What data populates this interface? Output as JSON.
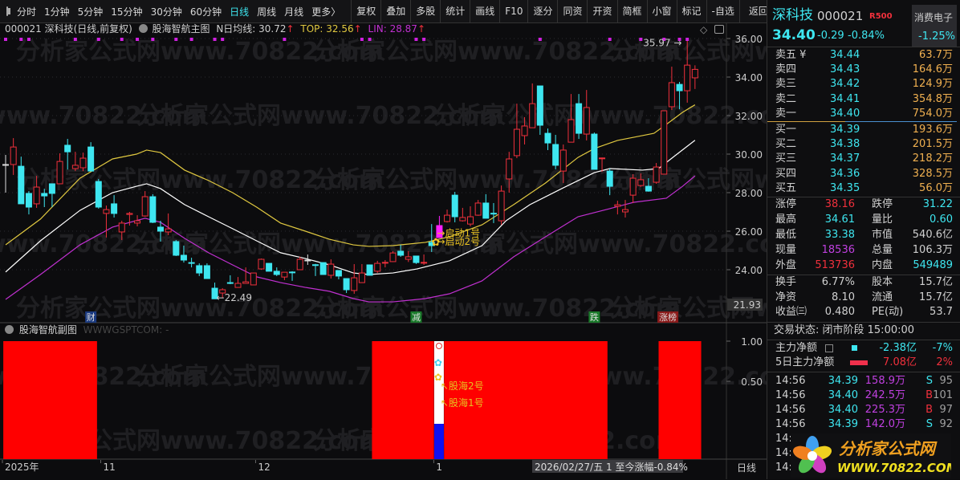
{
  "toolbar": {
    "periods": [
      "分时",
      "1分钟",
      "5分钟",
      "15分钟",
      "30分钟",
      "60分钟",
      "日线",
      "周线",
      "月线",
      "更多〉"
    ],
    "active_period": "日线",
    "buttons": [
      "复权",
      "叠加",
      "多股",
      "统计",
      "画线",
      "F10",
      "逐分",
      "同资",
      "开资",
      "简框",
      "小窗",
      "标记",
      "-自选",
      "返回"
    ]
  },
  "colors": {
    "up": "#f0303c",
    "down": "#3ee6f0",
    "top_line": "#e0c840",
    "n_line": "#ffffff",
    "lin_line": "#c030d0",
    "signal_block": "#ff0000",
    "signal_blue": "#1010f0",
    "marker": "#d020e0"
  },
  "chart_header": {
    "title": "000021 深科技(日线,前复权)",
    "indicator": "股海智航主图",
    "n_label": "N日均线: 30.72",
    "top_label": "TOP: 32.56",
    "lin_label": "LIN: 28.87",
    "arrow": "↑"
  },
  "watermark": "分析家公式网www.70822.com",
  "chart_data": {
    "type": "candlestick",
    "ylim": [
      21.93,
      36.5
    ],
    "y_ticks": [
      "36.00",
      "34.00",
      "32.00",
      "30.00",
      "28.00",
      "26.00",
      "24.00"
    ],
    "y_tick_values": [
      36,
      34,
      32,
      30,
      28,
      26,
      24
    ],
    "axis_low_label": "21.93",
    "candles": [
      [
        29.46,
        29.96,
        28.0,
        29.46,
        "w"
      ],
      [
        29.46,
        30.83,
        28.92,
        30.37
      ],
      [
        29.37,
        29.87,
        27.42,
        27.42
      ],
      [
        27.96,
        28.08,
        26.87,
        27.25
      ],
      [
        27.42,
        28.87,
        27.21,
        28.29
      ],
      [
        27.96,
        28.2,
        27.25,
        27.83
      ],
      [
        28.46,
        28.46,
        27.25,
        27.96
      ],
      [
        28.46,
        30.04,
        28.46,
        29.62
      ],
      [
        30.46,
        30.79,
        29.2,
        30.12
      ],
      [
        29.25,
        30.12,
        29.12,
        29.42
      ],
      [
        29.29,
        30.08,
        29.12,
        29.79
      ],
      [
        30.37,
        30.62,
        29.12,
        29.12
      ],
      [
        28.58,
        28.71,
        27.17,
        27.25
      ],
      [
        26.92,
        27.33,
        25.67,
        27.12
      ],
      [
        27.42,
        27.87,
        26.71,
        26.92
      ],
      [
        25.96,
        26.54,
        25.54,
        26.42
      ],
      [
        26.87,
        27.0,
        26.29,
        26.92
      ],
      [
        26.42,
        26.83,
        26.25,
        26.54
      ],
      [
        26.79,
        28.08,
        26.75,
        27.79
      ],
      [
        27.79,
        27.92,
        26.42,
        26.46
      ],
      [
        26.21,
        26.54,
        25.46,
        26.0
      ],
      [
        25.96,
        26.92,
        25.79,
        26.12
      ],
      [
        25.46,
        25.54,
        24.71,
        24.75
      ],
      [
        24.75,
        25.25,
        24.37,
        24.5
      ],
      [
        24.37,
        24.62,
        24.12,
        24.33
      ],
      [
        24.21,
        24.33,
        23.67,
        23.83
      ],
      [
        24.21,
        24.33,
        23.54,
        23.54
      ],
      [
        23.04,
        23.33,
        22.49,
        22.49
      ],
      [
        22.79,
        23.04,
        22.54,
        22.96
      ],
      [
        23.33,
        23.71,
        23.25,
        23.29
      ],
      [
        23.08,
        23.62,
        23.08,
        23.29
      ],
      [
        23.29,
        24.12,
        23.29,
        23.37
      ],
      [
        23.21,
        23.83,
        23.21,
        23.83
      ],
      [
        24.04,
        24.58,
        24.0,
        24.54
      ],
      [
        24.33,
        24.33,
        23.92,
        23.92
      ],
      [
        23.92,
        24.12,
        23.67,
        23.75
      ],
      [
        23.62,
        23.87,
        23.46,
        23.87
      ],
      [
        23.88,
        23.92,
        23.42,
        23.86
      ],
      [
        24.0,
        24.67,
        24.0,
        24.54
      ],
      [
        24.5,
        24.79,
        24.25,
        24.5,
        "w"
      ],
      [
        24.26,
        24.3,
        23.67,
        24.24
      ],
      [
        24.37,
        24.37,
        23.75,
        23.75
      ],
      [
        23.71,
        24.54,
        23.54,
        24.29
      ],
      [
        23.96,
        23.96,
        23.5,
        23.67
      ],
      [
        23.54,
        23.54,
        22.79,
        22.96
      ],
      [
        22.92,
        24.29,
        22.75,
        23.58
      ],
      [
        23.33,
        24.29,
        23.33,
        23.83
      ],
      [
        24.25,
        24.25,
        23.71,
        23.71
      ],
      [
        23.92,
        24.46,
        23.83,
        24.33
      ],
      [
        24.36,
        24.5,
        24.12,
        24.38
      ],
      [
        24.42,
        24.96,
        24.4,
        24.87
      ],
      [
        24.96,
        25.29,
        24.67,
        24.75
      ],
      [
        24.54,
        24.96,
        24.4,
        24.67
      ],
      [
        24.71,
        24.71,
        24.3,
        24.37
      ],
      [
        24.36,
        24.79,
        24.25,
        24.38
      ],
      [
        25.42,
        26.37,
        24.92,
        25.25
      ],
      [
        25.67,
        26.79,
        25.67,
        26.29,
        "m"
      ],
      [
        26.5,
        27.12,
        26.45,
        26.83
      ],
      [
        27.87,
        28.04,
        26.46,
        26.75
      ],
      [
        26.54,
        27.21,
        26.5,
        26.71
      ],
      [
        26.37,
        27.29,
        26.25,
        26.75
      ],
      [
        26.83,
        27.62,
        26.8,
        27.46
      ],
      [
        27.46,
        27.92,
        26.67,
        26.67
      ],
      [
        26.93,
        27.46,
        26.42,
        26.91
      ],
      [
        26.54,
        28.37,
        26.33,
        28.08
      ],
      [
        28.71,
        30.12,
        28.0,
        29.75
      ],
      [
        29.92,
        32.62,
        29.79,
        31.29
      ],
      [
        30.96,
        31.92,
        30.5,
        31.46
      ],
      [
        31.37,
        33.67,
        31.37,
        32.62
      ],
      [
        33.54,
        33.54,
        31.0,
        31.5
      ],
      [
        31.08,
        31.33,
        30.21,
        30.58
      ],
      [
        30.5,
        31.0,
        29.21,
        29.42
      ],
      [
        29.12,
        30.5,
        28.5,
        30.21
      ],
      [
        30.62,
        33.12,
        30.62,
        31.79
      ],
      [
        32.62,
        33.12,
        30.79,
        31.08
      ],
      [
        31.04,
        33.33,
        30.71,
        32.42
      ],
      [
        31.04,
        31.12,
        29.21,
        29.21
      ],
      [
        29.78,
        29.82,
        29.08,
        29.8
      ],
      [
        29.12,
        29.25,
        27.87,
        28.33
      ],
      [
        27.29,
        27.58,
        26.87,
        27.37
      ],
      [
        27.0,
        27.62,
        26.71,
        27.12
      ],
      [
        27.87,
        28.96,
        27.46,
        28.75
      ],
      [
        28.37,
        29.0,
        28.3,
        28.67
      ],
      [
        28.33,
        28.75,
        28.05,
        28.08
      ],
      [
        28.54,
        29.54,
        28.46,
        29.33
      ],
      [
        28.96,
        32.25,
        28.96,
        32.25
      ],
      [
        32.46,
        34.54,
        32.29,
        33.71
      ],
      [
        33.62,
        33.75,
        32.33,
        33.29
      ],
      [
        33.29,
        35.97,
        32.67,
        34.62
      ],
      [
        33.96,
        34.61,
        33.38,
        34.4
      ]
    ],
    "series": [
      {
        "name": "TOP",
        "points": [
          [
            0,
            25.29
          ],
          [
            4.5,
            26.63
          ],
          [
            9.6,
            28.75
          ],
          [
            13.8,
            29.75
          ],
          [
            16.9,
            30.0
          ],
          [
            18.2,
            30.21
          ],
          [
            20,
            30.08
          ],
          [
            23.1,
            29.17
          ],
          [
            26.2,
            28.63
          ],
          [
            29.3,
            28.0
          ],
          [
            32.4,
            27.25
          ],
          [
            35.5,
            26.42
          ],
          [
            38.7,
            26.0
          ],
          [
            41.8,
            25.58
          ],
          [
            44.9,
            25.29
          ],
          [
            46.9,
            25.21
          ],
          [
            50,
            25.25
          ],
          [
            54.2,
            25.42
          ],
          [
            57.3,
            25.71
          ],
          [
            61.5,
            26.33
          ],
          [
            65.6,
            27.38
          ],
          [
            69.7,
            28.5
          ],
          [
            73.9,
            29.83
          ],
          [
            76,
            30.29
          ],
          [
            79,
            30.71
          ],
          [
            82.2,
            30.96
          ],
          [
            83.7,
            31.08
          ],
          [
            85.3,
            31.54
          ],
          [
            87.4,
            32.17
          ],
          [
            89,
            32.56
          ]
        ]
      },
      {
        "name": "N",
        "points": [
          [
            0,
            23.88
          ],
          [
            4.5,
            25.5
          ],
          [
            9.6,
            27.08
          ],
          [
            13.8,
            28.0
          ],
          [
            16.9,
            28.33
          ],
          [
            18.2,
            28.46
          ],
          [
            20,
            28.21
          ],
          [
            23.1,
            27.38
          ],
          [
            26.2,
            26.75
          ],
          [
            29.3,
            26.13
          ],
          [
            32.4,
            25.5
          ],
          [
            35.5,
            24.88
          ],
          [
            38.7,
            24.58
          ],
          [
            41.8,
            24.25
          ],
          [
            44.9,
            23.83
          ],
          [
            46.9,
            23.75
          ],
          [
            50,
            23.83
          ],
          [
            53.1,
            24.04
          ],
          [
            57.3,
            24.46
          ],
          [
            61.5,
            25.25
          ],
          [
            64.6,
            26.54
          ],
          [
            67.7,
            27.38
          ],
          [
            71.8,
            28.21
          ],
          [
            76,
            29.04
          ],
          [
            78,
            29.25
          ],
          [
            82.2,
            29.17
          ],
          [
            84.3,
            29.25
          ],
          [
            86.3,
            29.88
          ],
          [
            89,
            30.72
          ]
        ]
      },
      {
        "name": "LIN",
        "points": [
          [
            0,
            22.46
          ],
          [
            4.5,
            23.75
          ],
          [
            9.6,
            25.29
          ],
          [
            13.8,
            26.21
          ],
          [
            18,
            26.67
          ],
          [
            20,
            26.46
          ],
          [
            23.1,
            25.63
          ],
          [
            26.2,
            24.88
          ],
          [
            29.3,
            24.25
          ],
          [
            32.4,
            23.63
          ],
          [
            35.5,
            23.33
          ],
          [
            38.7,
            23.08
          ],
          [
            41.8,
            22.88
          ],
          [
            44.9,
            22.5
          ],
          [
            46.9,
            22.33
          ],
          [
            50,
            22.33
          ],
          [
            54.2,
            22.5
          ],
          [
            57.3,
            22.75
          ],
          [
            61.5,
            23.42
          ],
          [
            65.6,
            24.67
          ],
          [
            69.7,
            25.71
          ],
          [
            73.9,
            26.75
          ],
          [
            78,
            27.17
          ],
          [
            81.1,
            27.5
          ],
          [
            85.3,
            27.71
          ],
          [
            87.4,
            28.33
          ],
          [
            89,
            28.87
          ]
        ]
      }
    ],
    "top_markers": [
      0,
      2,
      3,
      9,
      12,
      15,
      17,
      19,
      22,
      24,
      27,
      28,
      36,
      46,
      47,
      53,
      54,
      69,
      78,
      82,
      85,
      87,
      88
    ],
    "annotations": [
      {
        "text": "22.49",
        "index": 27,
        "price": 22.49
      },
      {
        "text": "35.97",
        "index": 88,
        "price": 35.97
      },
      {
        "text": "→启动1号",
        "index": 56,
        "price": 25.9
      },
      {
        "text": "→启动2号",
        "index": 56,
        "price": 25.45
      }
    ],
    "signals": [
      {
        "text": "财",
        "index": 11,
        "bg": "#1a3a80"
      },
      {
        "text": "减",
        "index": 53,
        "bg": "#1a7a2a"
      },
      {
        "text": "跌",
        "index": 76,
        "bg": "#1a7a2a"
      },
      {
        "text": "涨榜",
        "index": 85.5,
        "bg": "#8a1a1a"
      }
    ],
    "sub": {
      "title": "股海智航副图",
      "subtitle": "WWWGSPTCOM: -",
      "y_ticks": [
        "1.00",
        "0.50"
      ],
      "blocks": [
        [
          -0.3,
          11.8
        ],
        [
          47.3,
          55.3
        ],
        [
          56.6,
          77.7
        ],
        [
          84.3,
          89.8
        ]
      ],
      "signal_index": 55.95,
      "labels": [
        "股海2号",
        "股海1号"
      ]
    },
    "x_labels": [
      {
        "text": "2025年",
        "index": 0
      },
      {
        "text": "11",
        "index": 13
      },
      {
        "text": "12",
        "index": 33
      },
      {
        "text": "1",
        "index": 56
      }
    ],
    "cursor_info": "2026/02/27/五 1 至今涨幅-0.84%",
    "period_label": "日线"
  },
  "quote": {
    "name": "深科技",
    "code": "000021",
    "badge": "R500",
    "sector": "消费电子",
    "sector_change": "-1.25%",
    "price": "34.40",
    "change": "-0.29",
    "change_pct": "-0.84%",
    "asks": [
      [
        "卖五 ¥",
        "34.44",
        "63.7万"
      ],
      [
        "卖四",
        "34.43",
        "164.6万"
      ],
      [
        "卖三",
        "34.42",
        "124.9万"
      ],
      [
        "卖二",
        "34.41",
        "354.8万"
      ],
      [
        "卖一",
        "34.40",
        "754.0万"
      ]
    ],
    "bids": [
      [
        "买一",
        "34.39",
        "193.6万"
      ],
      [
        "买二",
        "34.38",
        "201.5万"
      ],
      [
        "买三",
        "34.37",
        "218.2万"
      ],
      [
        "买四",
        "34.36",
        "328.5万"
      ],
      [
        "买五",
        "34.35",
        "56.0万"
      ]
    ],
    "stats": [
      [
        "涨停",
        "38.16",
        "跌停",
        "31.22"
      ],
      [
        "最高",
        "34.61",
        "量比",
        "0.60"
      ],
      [
        "最低",
        "33.38",
        "市值",
        "540.6亿"
      ],
      [
        "现量",
        "18536",
        "总量",
        "106.3万"
      ],
      [
        "外盘",
        "513736",
        "内盘",
        "549489"
      ]
    ],
    "fundamentals": [
      [
        "换手",
        "6.77%",
        "股本",
        "15.7亿"
      ],
      [
        "净资",
        "8.10",
        "流通",
        "15.7亿"
      ],
      [
        "收益㈢",
        "0.480",
        "PE(动)",
        "53.7"
      ]
    ],
    "status": "交易状态: 闭市阶段 15:00:00",
    "flows": [
      [
        "主力净额",
        "-2.38亿",
        "-7%"
      ],
      [
        "5日主力净额",
        "7.08亿",
        "2%"
      ]
    ],
    "ticks": [
      [
        "14:56",
        "34.39",
        "158.9万",
        "S",
        "95"
      ],
      [
        "14:56",
        "34.40",
        "242.5万",
        "B",
        "101"
      ],
      [
        "14:56",
        "34.40",
        "225.3万",
        "B",
        "97"
      ],
      [
        "14:56",
        "34.39",
        "142.0万",
        "S",
        "92"
      ],
      [
        "14:5",
        "",
        "",
        "",
        ""
      ],
      [
        "14:5",
        "",
        "",
        "",
        ""
      ],
      [
        "14:5",
        "",
        "",
        "",
        ""
      ]
    ],
    "logo_text": "分析家公式网",
    "logo_url": "WWW.70822.COM"
  }
}
